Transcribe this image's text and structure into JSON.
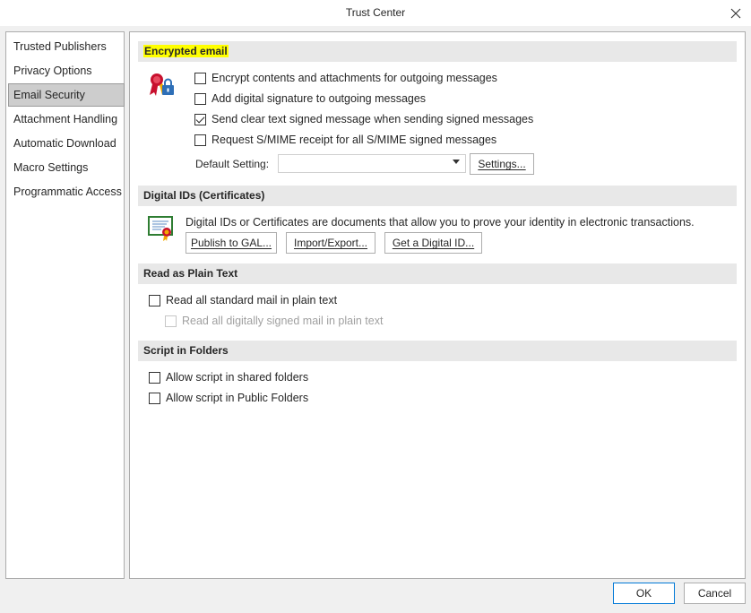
{
  "window": {
    "title": "Trust Center",
    "close_icon": "close-icon"
  },
  "sidebar": {
    "items": [
      {
        "label": "Trusted Publishers"
      },
      {
        "label": "Privacy Options"
      },
      {
        "label": "Email Security"
      },
      {
        "label": "Attachment Handling"
      },
      {
        "label": "Automatic Download"
      },
      {
        "label": "Macro Settings"
      },
      {
        "label": "Programmatic Access"
      }
    ],
    "selected": "Email Security"
  },
  "encrypted_email": {
    "header": "Encrypted email",
    "icon": "certificate-lock-icon",
    "options": [
      {
        "label": "Encrypt contents and attachments for outgoing messages",
        "checked": false
      },
      {
        "label": "Add digital signature to outgoing messages",
        "checked": false
      },
      {
        "label": "Send clear text signed message when sending signed messages",
        "checked": true
      },
      {
        "label": "Request S/MIME receipt for all S/MIME signed messages",
        "checked": false
      }
    ],
    "default_setting_label": "Default Setting:",
    "default_setting_value": "",
    "settings_button": "Settings..."
  },
  "digital_ids": {
    "header": "Digital IDs (Certificates)",
    "icon": "certificate-icon",
    "description": "Digital IDs or Certificates are documents that allow you to prove your identity in electronic transactions.",
    "buttons": {
      "publish": "Publish to GAL...",
      "import_export": "Import/Export...",
      "get_id": "Get a Digital ID..."
    }
  },
  "plain_text": {
    "header": "Read as Plain Text",
    "options": [
      {
        "label": "Read all standard mail in plain text",
        "checked": false,
        "disabled": false
      },
      {
        "label": "Read all digitally signed mail in plain text",
        "checked": false,
        "disabled": true
      }
    ]
  },
  "script_folders": {
    "header": "Script in Folders",
    "options": [
      {
        "label": "Allow script in shared folders",
        "checked": false
      },
      {
        "label": "Allow script in Public Folders",
        "checked": false
      }
    ]
  },
  "footer": {
    "ok": "OK",
    "cancel": "Cancel"
  },
  "colors": {
    "highlight": "#ffff00",
    "accent": "#0078d7",
    "header_bg": "#e8e8e8"
  }
}
